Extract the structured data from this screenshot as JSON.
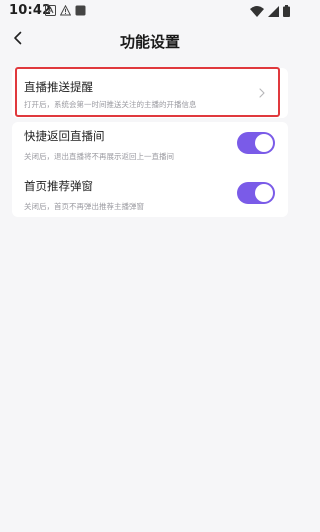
{
  "status_bar": {
    "time": "10:42",
    "icons": [
      "notification-a-icon",
      "notification-warning-icon",
      "notification-square-icon",
      "wifi-icon",
      "signal-icon",
      "battery-icon"
    ]
  },
  "header": {
    "title": "功能设置",
    "back_icon": "chevron-left-icon"
  },
  "settings": [
    {
      "title": "直播推送提醒",
      "description": "打开后，系统会第一时间推送关注的主播的开播信息",
      "control": "chevron-right-icon"
    },
    {
      "title": "快捷返回直播间",
      "description": "关闭后，退出直播将不再展示返回上一直播间",
      "control": "toggle",
      "enabled": true
    },
    {
      "title": "首页推荐弹窗",
      "description": "关闭后，首页不再弹出推荐主播弹窗",
      "control": "toggle",
      "enabled": true
    }
  ],
  "colors": {
    "background": "#f6f6f8",
    "card": "#ffffff",
    "toggle_on": "#7a5be8",
    "highlight": "#e0393d",
    "description_text": "#9a9aa0"
  }
}
